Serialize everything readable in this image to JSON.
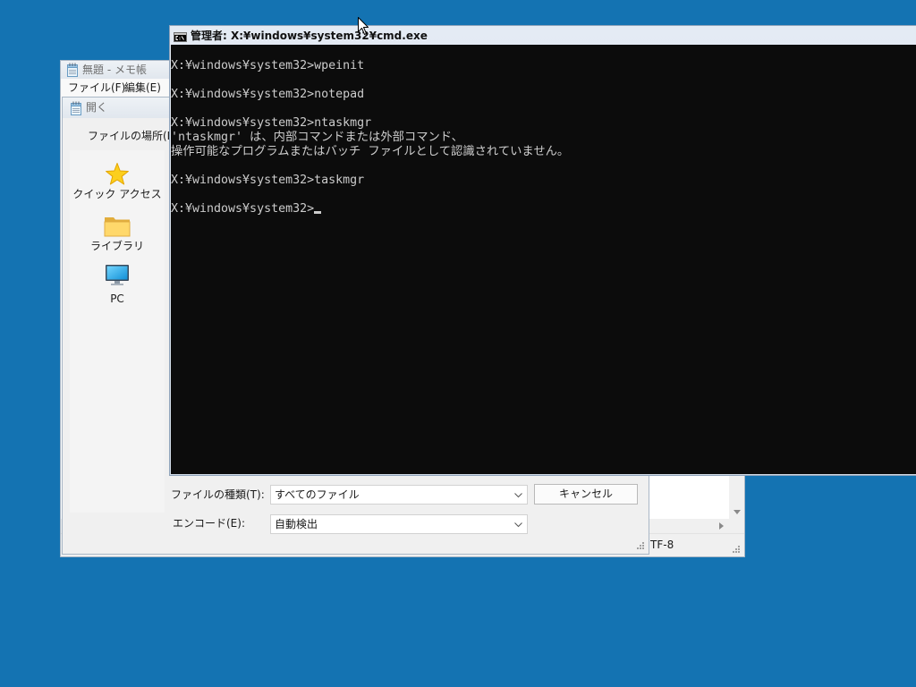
{
  "colors": {
    "desktop_background": "#1473b2",
    "console_background": "#0c0c0c",
    "console_text": "#cccccc",
    "window_title_bar": "#e1e7ee",
    "dialog_background": "#f0f0f0"
  },
  "notepad": {
    "icon": "notepad-icon",
    "title": "無題 - メモ帳",
    "menu": [
      {
        "label": "ファイル(F)"
      },
      {
        "label": "編集(E)"
      }
    ],
    "status": {
      "encoding": "TF-8"
    }
  },
  "open_dialog": {
    "icon": "notepad-icon",
    "title": "開く",
    "location_label": "ファイルの場所(I):",
    "places": [
      {
        "icon": "star-icon",
        "label": "クイック アクセス"
      },
      {
        "icon": "folder-icon",
        "label": "ライブラリ"
      },
      {
        "icon": "monitor-icon",
        "label": "PC"
      }
    ],
    "file_type": {
      "label": "ファイルの種類(T):",
      "value": "すべてのファイル"
    },
    "encoding": {
      "label": "エンコード(E):",
      "value": "自動検出"
    },
    "cancel_label": "キャンセル"
  },
  "cmd": {
    "icon": "cmd-icon",
    "title": "管理者: X:¥windows¥system32¥cmd.exe",
    "output": [
      "X:¥windows¥system32>wpeinit",
      "X:¥windows¥system32>notepad",
      "X:¥windows¥system32>ntaskmgr",
      "'ntaskmgr' は、内部コマンドまたは外部コマンド、",
      "操作可能なプログラムまたはバッチ ファイルとして認識されていません。",
      "X:¥windows¥system32>taskmgr"
    ],
    "prompt": "X:¥windows¥system32>"
  },
  "pointer": {
    "icon": "arrow-cursor-icon"
  }
}
